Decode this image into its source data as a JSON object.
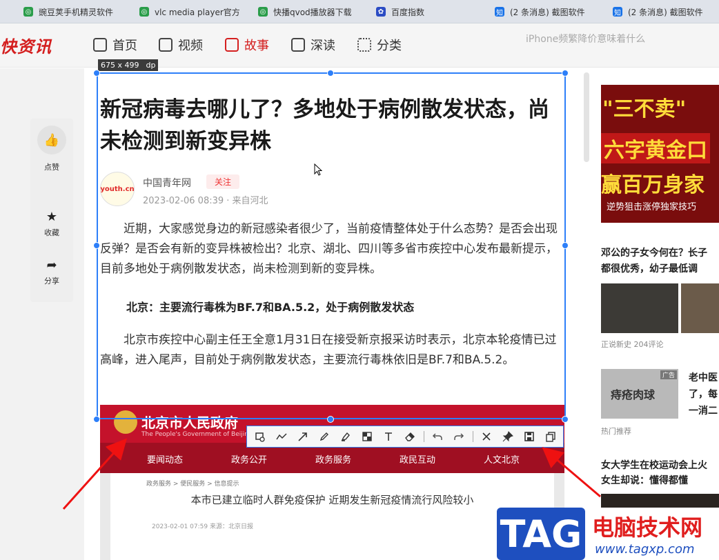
{
  "tabs": [
    {
      "label": "豌豆荚手机精灵软件",
      "icon": "swirl-icon",
      "color": "#2a9d4a"
    },
    {
      "label": "vlc media player官方",
      "icon": "swirl-icon",
      "color": "#2a9d4a"
    },
    {
      "label": "快播qvod播放器下载",
      "icon": "swirl-icon",
      "color": "#2a9d4a"
    },
    {
      "label": "百度指数",
      "icon": "paw-icon",
      "color": "#2b4cc4"
    },
    {
      "label": "(2 条消息) 截图软件",
      "icon": "zhihu-icon",
      "color": "#1a73e8"
    },
    {
      "label": "(2 条消息) 截图软件",
      "icon": "zhihu-icon",
      "color": "#1a73e8"
    }
  ],
  "site": {
    "logo": "快资讯",
    "nav": [
      {
        "label": "首页",
        "icon": "home-icon",
        "active": false
      },
      {
        "label": "视频",
        "icon": "tv-icon",
        "active": false
      },
      {
        "label": "故事",
        "icon": "book-icon",
        "active": true
      },
      {
        "label": "深读",
        "icon": "doc-icon",
        "active": false
      },
      {
        "label": "分类",
        "icon": "grid-icon",
        "active": false
      }
    ],
    "search_placeholder": "iPhone频繁降价意味着什么"
  },
  "sidebar": {
    "like": "点赞",
    "favorite": "收藏",
    "share": "分享"
  },
  "selection": {
    "dimensions": "675 x 499",
    "unit": "dp"
  },
  "article": {
    "title": "新冠病毒去哪儿了？多地处于病例散发状态，尚未检测到新变异株",
    "avatar_text": "youth.cn",
    "source": "中国青年网",
    "follow": "关注",
    "date": "2023-02-06 08:39 · 来自河北",
    "para1": "近期，大家感觉身边的新冠感染者很少了，当前疫情整体处于什么态势？是否会出现反弹？是否会有新的变异株被检出？北京、湖北、四川等多省市疾控中心发布最新提示，目前多地处于病例散发状态，尚未检测到新的变异株。",
    "subhead": "北京：主要流行毒株为BF.7和BA.5.2，处于病例散发状态",
    "para2": "北京市疾控中心副主任王全意1月31日在接受新京报采访时表示，北京本轮疫情已过高峰，进入尾声，目前处于病例散发状态，主要流行毒株依旧是BF.7和BA.5.2。"
  },
  "gov": {
    "name": "北京市人民政府",
    "english": "The People's Government of Beijing Municipality",
    "nav": [
      "要闻动态",
      "政务公开",
      "政务服务",
      "政民互动",
      "人文北京"
    ],
    "crumb": "政务服务 > 便民服务 > 信息提示",
    "title": "本市已建立临时人群免疫保护 近期发生新冠疫情流行风险较小",
    "date": "2023-02-01 07:59  来源：北京日报"
  },
  "toolbar": {
    "tools": [
      "rectangle-tool-icon",
      "polyline-tool-icon",
      "arrow-tool-icon",
      "pencil-tool-icon",
      "marker-tool-icon",
      "mosaic-tool-icon",
      "text-tool-icon",
      "eraser-tool-icon",
      "undo-icon",
      "redo-icon",
      "close-icon",
      "pin-icon",
      "save-icon",
      "copy-icon"
    ]
  },
  "right": {
    "ad_line1": "\"三不卖\"",
    "ad_line2": "六字黄金口",
    "ad_line3": "赢百万身家",
    "ad_line4": "逆势狙击涨停独家技巧",
    "news1_line1": "邓公的子女今何在？长子",
    "news1_line2": "都很优秀，幼子最低调",
    "news1_meta": "正说新史   204评论",
    "news2_line1": "老中医",
    "news2_line2": "了，每",
    "news2_line3": "一消二",
    "news2_img": "痔疮肉球",
    "news2_badge": "广告",
    "news2_meta": "热门推荐",
    "news3_line1": "女大学生在校运动会上火",
    "news3_line2": "女生却说：懂得都懂"
  },
  "watermark": {
    "tag": "TAG",
    "text": "电脑技术网",
    "url": "www.tagxp.com"
  }
}
